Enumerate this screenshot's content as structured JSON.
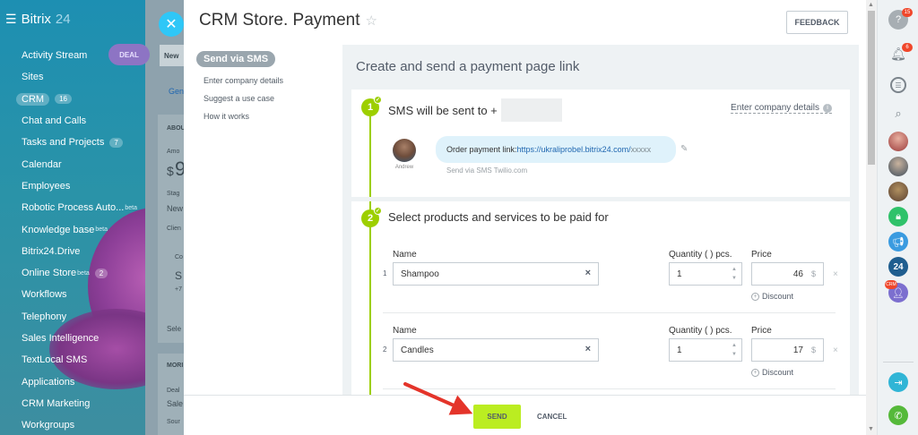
{
  "app": {
    "logo_word": "Bitrix",
    "logo_num": "24"
  },
  "sidebar": {
    "items": [
      {
        "label": "Activity Stream",
        "count": "",
        "sup": ""
      },
      {
        "label": "Sites",
        "count": "",
        "sup": ""
      },
      {
        "label": "CRM",
        "count": "16",
        "sup": "",
        "active": true
      },
      {
        "label": "Chat and Calls",
        "count": "",
        "sup": ""
      },
      {
        "label": "Tasks and Projects",
        "count": "7",
        "sup": ""
      },
      {
        "label": "Calendar",
        "count": "",
        "sup": ""
      },
      {
        "label": "Employees",
        "count": "",
        "sup": ""
      },
      {
        "label": "Robotic Process Auto...",
        "count": "",
        "sup": "beta"
      },
      {
        "label": "Knowledge base",
        "count": "",
        "sup": "beta"
      },
      {
        "label": "Bitrix24.Drive",
        "count": "",
        "sup": ""
      },
      {
        "label": "Online Store",
        "count": "2",
        "sup": "beta"
      },
      {
        "label": "Workflows",
        "count": "",
        "sup": ""
      },
      {
        "label": "Telephony",
        "count": "",
        "sup": ""
      },
      {
        "label": "Sales Intelligence",
        "count": "",
        "sup": ""
      },
      {
        "label": "TextLocal SMS",
        "count": "",
        "sup": ""
      },
      {
        "label": "Applications",
        "count": "",
        "sup": ""
      },
      {
        "label": "CRM Marketing",
        "count": "",
        "sup": ""
      },
      {
        "label": "Workgroups",
        "count": "",
        "sup": ""
      }
    ]
  },
  "background": {
    "deal_label": "DEAL",
    "new_label": "New",
    "gen_label": "Gen",
    "about_label": "ABOU",
    "amount_label": "Amo",
    "currency": "$",
    "amount_digit": "9",
    "stage_label": "Stag",
    "stage_value": "New",
    "client_label": "Clien",
    "more_label": "MORI",
    "deal_short": "Deal",
    "sale_short": "Sale",
    "source_short": "Sour",
    "sele_short": "Sele",
    "co_short": "Co",
    "s_short": "S",
    "plus_short": "+7"
  },
  "panel": {
    "title": "CRM Store. Payment",
    "feedback_label": "FEEDBACK",
    "nav_active": "Send via SMS",
    "nav_links": [
      "Enter company details",
      "Suggest a use case",
      "How it works"
    ],
    "content_title": "Create and send a payment page link"
  },
  "step1": {
    "number": "1",
    "title": "SMS will be sent to +",
    "enter_company": "Enter company details",
    "avatar_name": "Andrew",
    "message_text": "Order payment link: ",
    "message_link": "https://ukraliprobel.bitrix24.com/",
    "message_link_tail": "xxxxx",
    "sent_via": "Send via SMS Twilio.com"
  },
  "step2": {
    "number": "2",
    "title": "Select products and services to be paid for",
    "col_name": "Name",
    "col_qty": "Quantity ( ) pcs.",
    "col_price": "Price",
    "discount_label": "Discount",
    "rows": [
      {
        "num": "1",
        "name": "Shampoo",
        "qty": "1",
        "price": "46",
        "currency": "$"
      },
      {
        "num": "2",
        "name": "Candles",
        "qty": "1",
        "price": "17",
        "currency": "$"
      }
    ]
  },
  "footer": {
    "send_label": "SEND",
    "cancel_label": "CANCEL"
  },
  "right_bar": {
    "help_badge": "15",
    "notif_badge": "6",
    "b24_label": "24",
    "crm_tag": "CRM"
  },
  "colors": {
    "accent_green": "#9dcf00",
    "send_green": "#bbed21",
    "close_blue": "#2fc7f7",
    "badge_red": "#f0472b"
  }
}
